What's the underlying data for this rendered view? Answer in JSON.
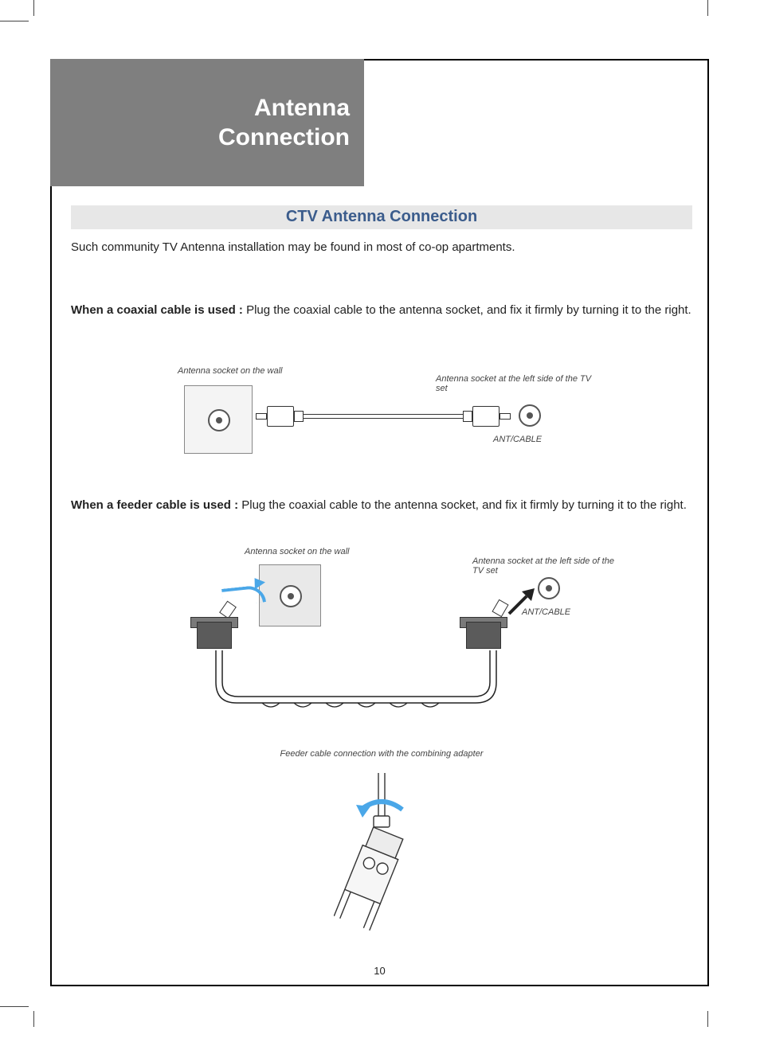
{
  "page": {
    "number": "10",
    "section_title_line1": "Antenna",
    "section_title_line2": "Connection",
    "heading": "CTV Antenna Connection",
    "intro": "Such community TV Antenna installation may be found in most of co-op apartments.",
    "step1_label": "When a coaxial cable is used :",
    "step1_text": " Plug the coaxial cable to the antenna socket, and fix it firmly by turning it to the right.",
    "step2_label": "When a feeder cable is used :",
    "step2_text": " Plug the coaxial cable to the antenna socket, and fix it firmly by turning it to the right.",
    "diagram1": {
      "wall_label": "Antenna socket on the wall",
      "tv_label": "Antenna socket at the left side of the TV set",
      "port_label": "ANT/CABLE"
    },
    "diagram2": {
      "wall_label": "Antenna socket on the wall",
      "tv_label": "Antenna socket at the left side of the TV set",
      "port_label": "ANT/CABLE"
    },
    "diagram3": {
      "caption": "Feeder cable connection with the combining adapter"
    }
  }
}
